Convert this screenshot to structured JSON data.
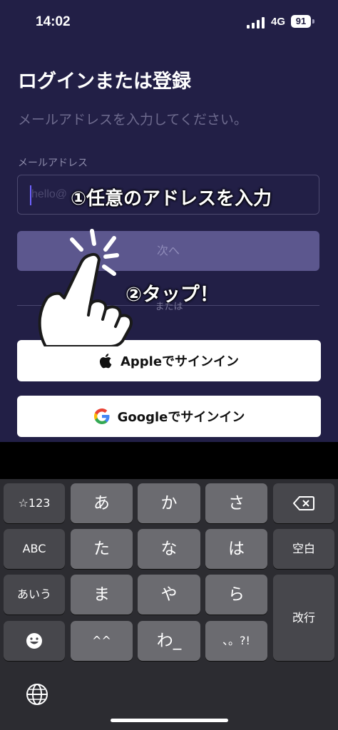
{
  "status_bar": {
    "time": "14:02",
    "network": "4G",
    "battery": "91"
  },
  "screen": {
    "title": "ログインまたは登録",
    "subtitle": "メールアドレスを入力してください。",
    "email_label": "メールアドレス",
    "email_placeholder": "hello@",
    "next_button": "次へ",
    "or_label": "または",
    "apple_button": "Appleでサインイン",
    "google_button": "Googleでサインイン"
  },
  "annotations": {
    "step1": "①任意のアドレスを入力",
    "step2": "②タップ！"
  },
  "keyboard": {
    "keys": [
      "☆123",
      "あ",
      "か",
      "さ",
      "ABC",
      "た",
      "な",
      "は",
      "空白",
      "あいう",
      "ま",
      "や",
      "ら",
      "改行",
      "^^",
      "わ_",
      "、。?!"
    ]
  }
}
